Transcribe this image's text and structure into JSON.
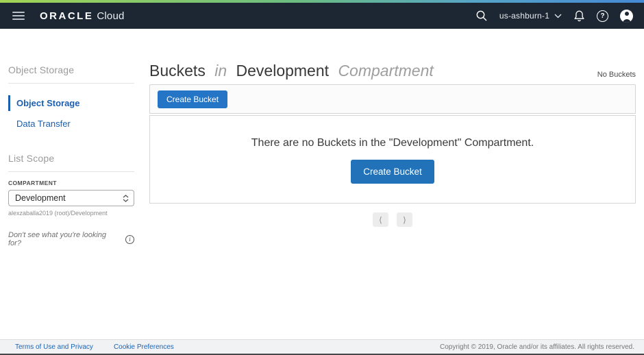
{
  "header": {
    "brand_oracle": "ORACLE",
    "brand_cloud": "Cloud",
    "region": "us-ashburn-1",
    "help_glyph": "?"
  },
  "sidebar": {
    "section_title": "Object Storage",
    "nav": [
      {
        "label": "Object Storage"
      },
      {
        "label": "Data Transfer"
      }
    ],
    "list_scope": {
      "title": "List Scope",
      "compartment_label": "COMPARTMENT",
      "compartment_value": "Development",
      "compartment_path": "alexzaballa2019 (root)/Development"
    },
    "help_text": "Don't see what you're looking for?",
    "info_glyph": "i"
  },
  "main": {
    "title": {
      "word1": "Buckets",
      "word2": "in",
      "word3": "Development",
      "word4": "Compartment"
    },
    "count_label": "No Buckets",
    "toolbar": {
      "create_button": "Create Bucket"
    },
    "empty_state": {
      "message": "There are no Buckets in the \"Development\" Compartment.",
      "create_button": "Create Bucket"
    },
    "pagination": {
      "prev_glyph": "⟨",
      "next_glyph": "⟩"
    }
  },
  "footer": {
    "links": [
      "Terms of Use and Privacy",
      "Cookie Preferences"
    ],
    "copyright": "Copyright © 2019, Oracle and/or its affiliates. All rights reserved."
  },
  "colors": {
    "header_bg": "#1d2733",
    "accent_blue": "#2172b8",
    "link_blue": "#1a5fb0",
    "gradient_left": "#a2d455",
    "gradient_mid": "#6cbe7f",
    "gradient_right": "#4489d4"
  }
}
